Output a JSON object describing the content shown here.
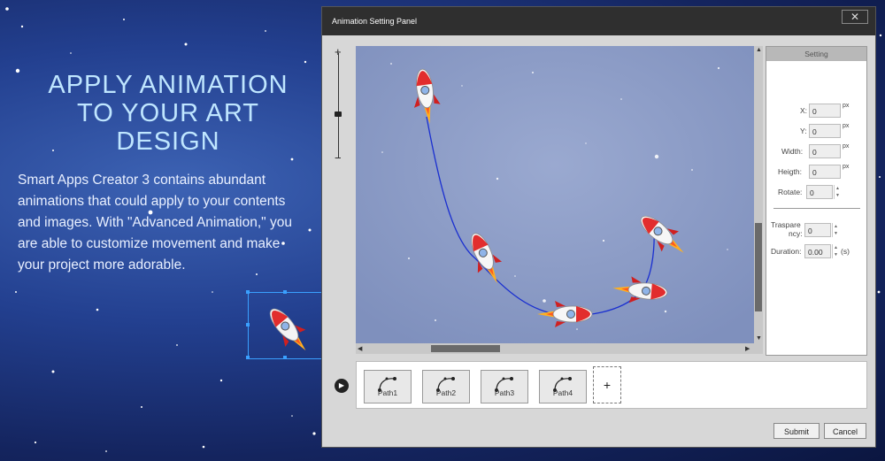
{
  "hero": {
    "title_line1": "APPLY ANIMATION",
    "title_line2": "TO YOUR ART",
    "title_line3": "DESIGN",
    "body": "Smart Apps Creator 3 contains abundant animations that could apply to your contents and images. With \"Advanced Animation,\" you are able to customize movement and make your project more adorable."
  },
  "panel": {
    "title": "Animation Setting Panel",
    "close_icon": "close-icon",
    "zoom": {
      "plus": "+",
      "minus": "−"
    },
    "setting": {
      "header": "Setting",
      "fields": {
        "x": {
          "label": "X:",
          "value": "0",
          "unit": "px"
        },
        "y": {
          "label": "Y:",
          "value": "0",
          "unit": "px"
        },
        "width": {
          "label": "Width:",
          "value": "0",
          "unit": "px"
        },
        "height": {
          "label": "Heigth:",
          "value": "0",
          "unit": "px"
        },
        "rotate": {
          "label": "Rotate:",
          "value": "0"
        },
        "transparency": {
          "label_line1": "Traspare",
          "label_line2": "ncy:",
          "value": "0"
        },
        "duration": {
          "label": "Duration:",
          "value": "0.00",
          "unit": "(s)"
        }
      }
    },
    "paths": [
      {
        "label": "Path1"
      },
      {
        "label": "Path2"
      },
      {
        "label": "Path3"
      },
      {
        "label": "Path4"
      }
    ],
    "add_path": "+",
    "submit": "Submit",
    "cancel": "Cancel"
  },
  "colors": {
    "path_line": "#1a2fd0",
    "accent": "#3aa0ff",
    "panel_head": "#2f2f2f"
  }
}
